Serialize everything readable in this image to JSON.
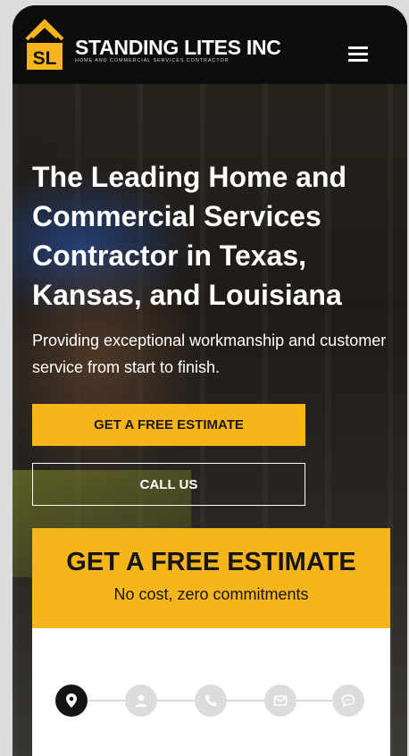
{
  "header": {
    "logo_text": "SL",
    "brand_name": "STANDING LITES INC",
    "brand_tagline": "HOME AND COMMERCIAL SERVICES CONTRACTOR",
    "menu_icon": "hamburger-icon"
  },
  "hero": {
    "title": "The Leading Home and Commercial Services Contractor in Texas, Kansas, and Louisiana",
    "subtitle": "Providing exceptional workmanship and customer service from start to finish.",
    "estimate_button": "GET A FREE ESTIMATE",
    "call_button": "CALL US"
  },
  "estimate_form": {
    "title": "GET A FREE ESTIMATE",
    "subtitle": "No cost, zero commitments",
    "steps": [
      {
        "icon": "location-pin-icon",
        "active": true
      },
      {
        "icon": "user-icon",
        "active": false
      },
      {
        "icon": "phone-icon",
        "active": false
      },
      {
        "icon": "envelope-icon",
        "active": false
      },
      {
        "icon": "chat-bubble-icon",
        "active": false
      }
    ]
  },
  "colors": {
    "accent": "#f7b51c",
    "header_bg": "#0d0d0d",
    "step_active": "#141414",
    "step_inactive": "#dcdcdc"
  }
}
